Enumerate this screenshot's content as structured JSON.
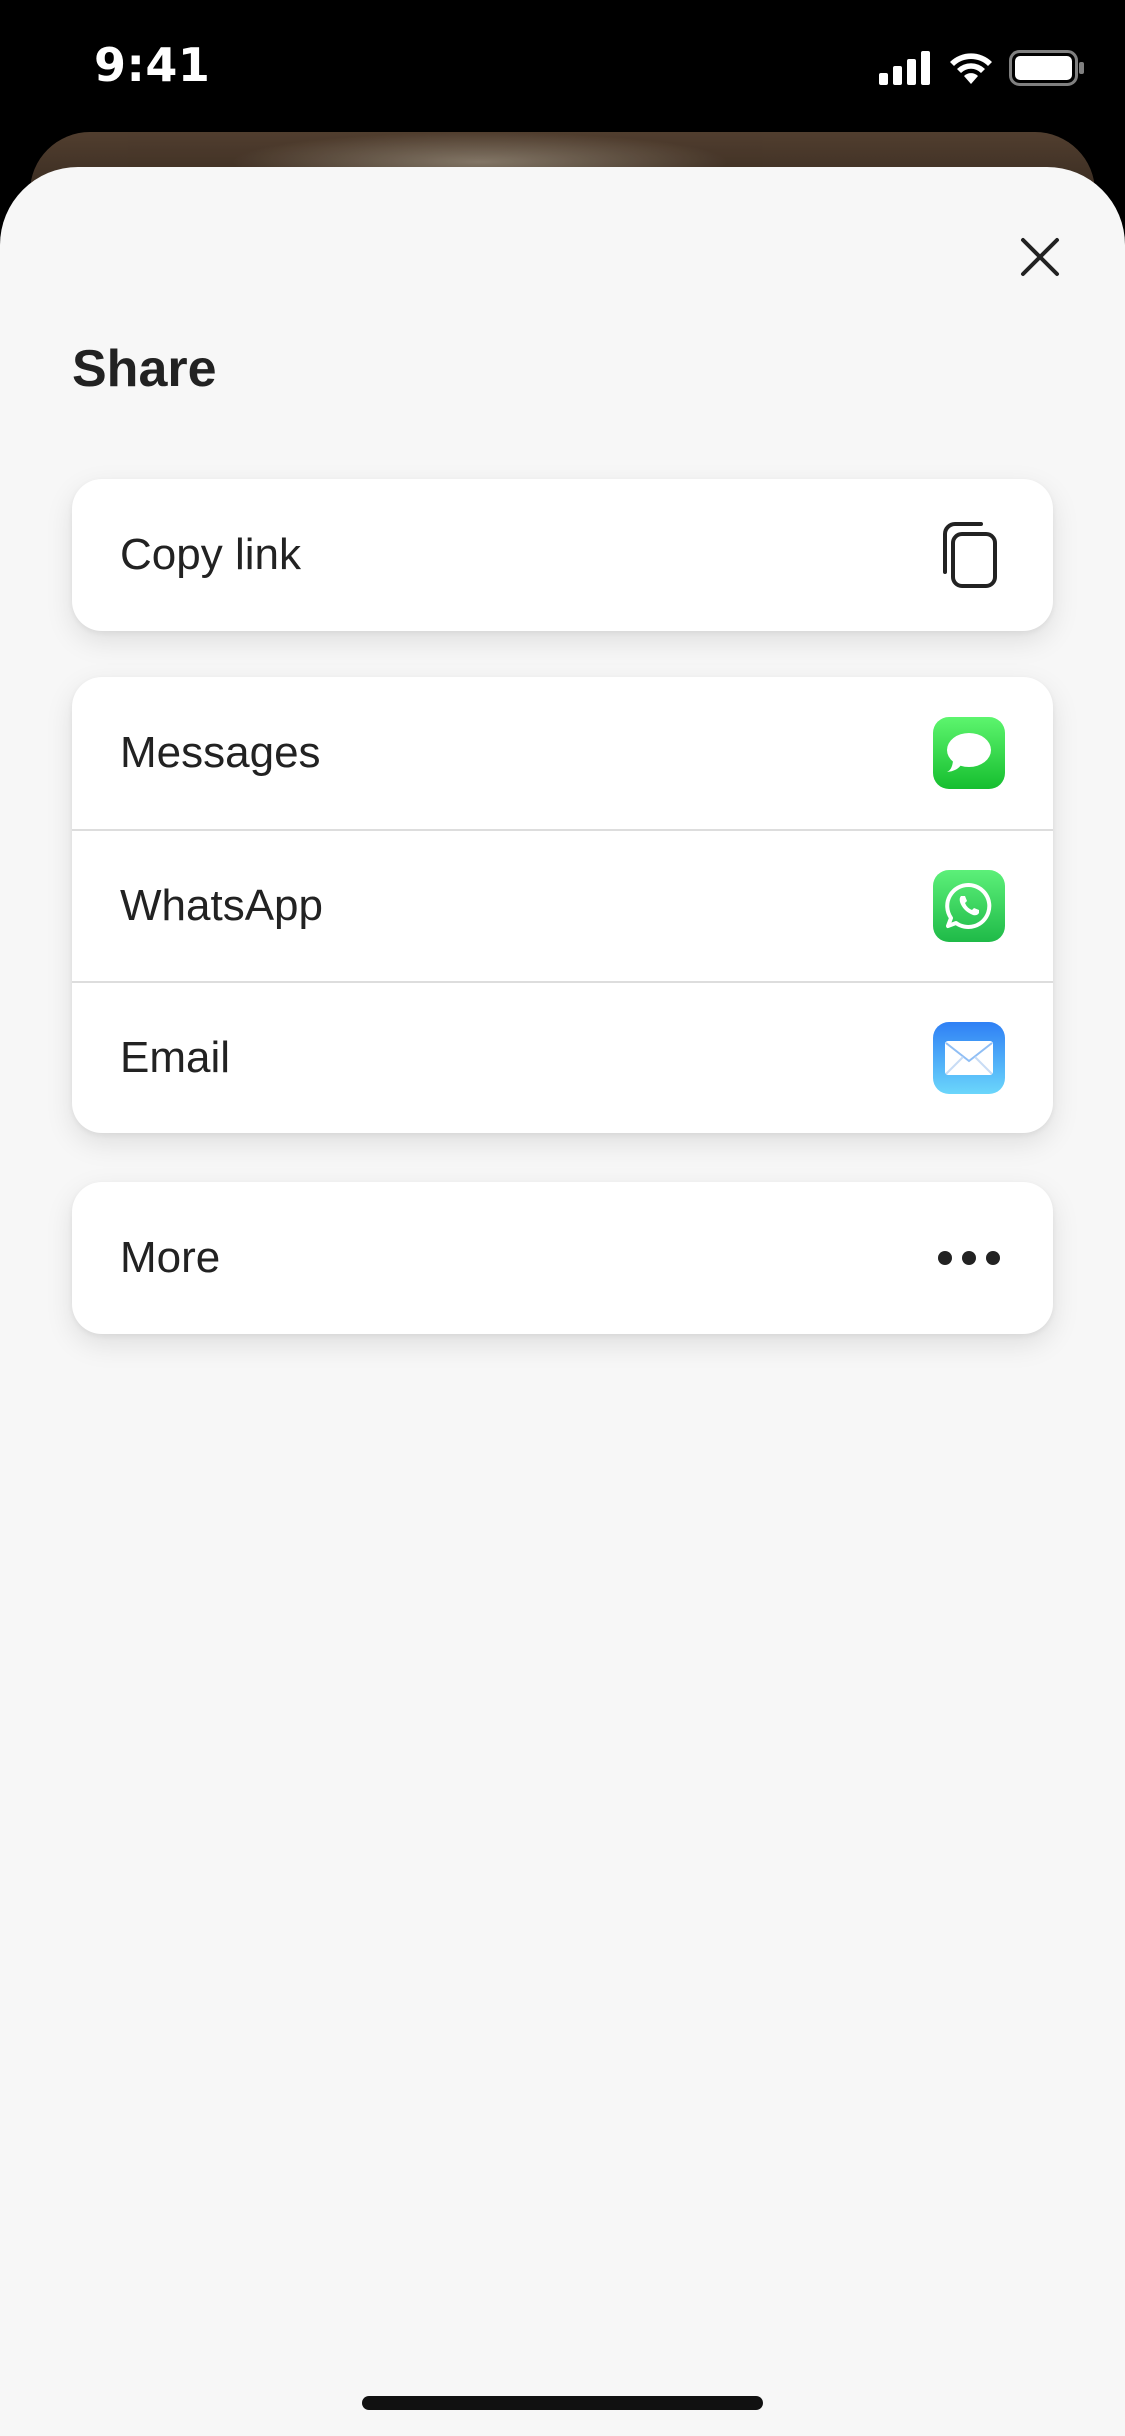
{
  "status_bar": {
    "time": "9:41"
  },
  "sheet": {
    "title": "Share",
    "close_icon": "close-icon",
    "groups": [
      {
        "items": [
          {
            "label": "Copy link",
            "icon": "copy-icon"
          }
        ]
      },
      {
        "items": [
          {
            "label": "Messages",
            "icon": "messages-app-icon",
            "color": "#34C759"
          },
          {
            "label": "WhatsApp",
            "icon": "whatsapp-app-icon",
            "color": "#25D366"
          },
          {
            "label": "Email",
            "icon": "mail-app-icon",
            "color": "#3B8BF7"
          }
        ]
      },
      {
        "items": [
          {
            "label": "More",
            "icon": "more-icon"
          }
        ]
      }
    ]
  },
  "colors": {
    "sheet_background": "#f7f7f7",
    "text": "#222222"
  }
}
